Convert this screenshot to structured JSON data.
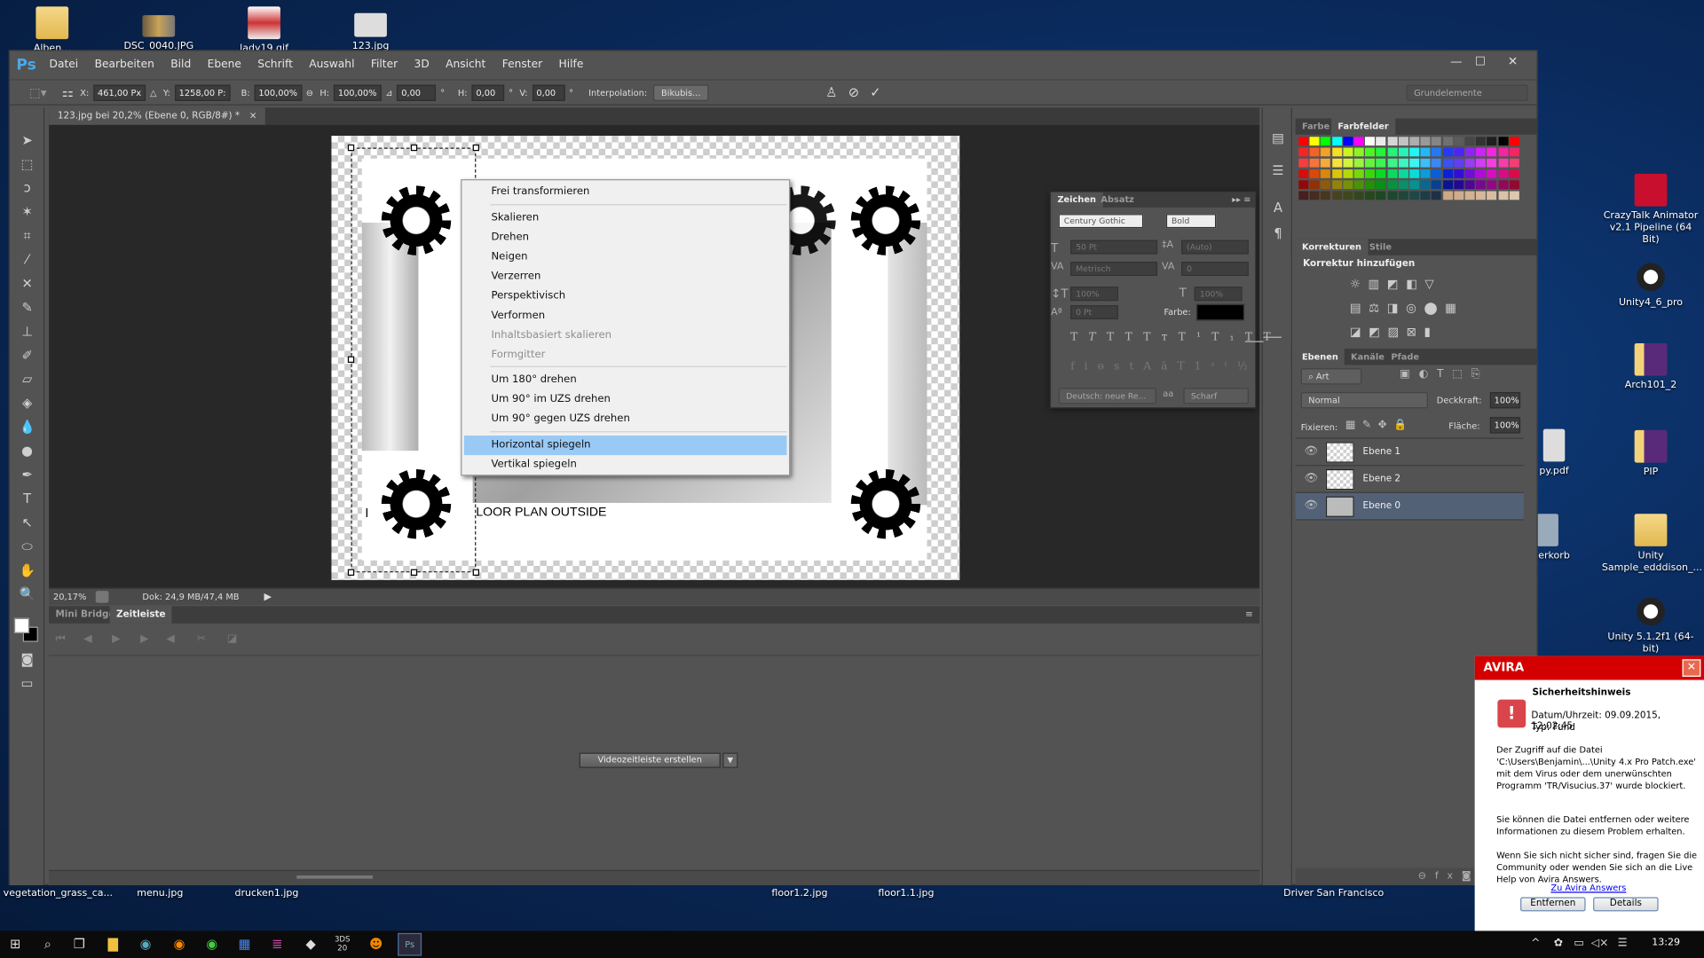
{
  "desktop": {
    "top_icons": [
      {
        "label": "Alben..."
      },
      {
        "label": "DSC_0040.JPG"
      },
      {
        "label": "lady19.gif"
      },
      {
        "label": "123.jpg"
      }
    ],
    "right_icons": [
      {
        "label": "CrazyTalk Animator v2.1 Pipeline (64 Bit)"
      },
      {
        "label": "Unity4_6_pro"
      },
      {
        "label": "Arch101_2"
      },
      {
        "label": "PIP"
      },
      {
        "label": "Unity Sample_edddison_..."
      },
      {
        "label": "Unity 5.1.2f1 (64-bit)"
      }
    ],
    "partial_icons": [
      {
        "label": "py.pdf"
      },
      {
        "label": "erkorb"
      }
    ],
    "bottom_labels": [
      "vegetation_grass_ca...",
      "menu.jpg",
      "drucken1.jpg",
      "floor1.2.jpg",
      "floor1.1.jpg",
      "Driver San Francisco"
    ]
  },
  "photoshop": {
    "logo": "Ps",
    "menu": [
      "Datei",
      "Bearbeiten",
      "Bild",
      "Ebene",
      "Schrift",
      "Auswahl",
      "Filter",
      "3D",
      "Ansicht",
      "Fenster",
      "Hilfe"
    ],
    "window_buttons": {
      "minimize": "—",
      "maximize": "☐",
      "close": "✕"
    },
    "options": {
      "x_label": "X:",
      "x": "461,00 Px",
      "y_label": "Y:",
      "y": "1258,00 P:",
      "b_label": "B:",
      "b": "100,00%",
      "h_label": "H:",
      "h": "100,00%",
      "angle": "0,00",
      "deg": "°",
      "hskew_label": "H:",
      "hskew": "0,00",
      "v_label": "V:",
      "v": "0,00",
      "interp_label": "Interpolation:",
      "interp": "Bikubis...",
      "workspace": "Grundelemente"
    },
    "doc_tab": "123.jpg bei 20,2% (Ebene 0, RGB/8#) *",
    "doc_tab_close": "×",
    "canvas_text": {
      "left": "I",
      "main": "LOOR PLAN OUTSIDE"
    },
    "status": {
      "zoom": "20,17%",
      "doc": "Dok: 24,9 MB/47,4 MB"
    },
    "timeline": {
      "tabs": [
        "Mini Bridge",
        "Zeitleiste"
      ],
      "active_tab": "Zeitleiste",
      "create_button": "Videozeitleiste erstellen"
    },
    "context_menu": {
      "items": [
        {
          "label": "Frei transformieren",
          "enabled": true
        },
        {
          "label": "Skalieren",
          "enabled": true
        },
        {
          "label": "Drehen",
          "enabled": true
        },
        {
          "label": "Neigen",
          "enabled": true
        },
        {
          "label": "Verzerren",
          "enabled": true
        },
        {
          "label": "Perspektivisch",
          "enabled": true
        },
        {
          "label": "Verformen",
          "enabled": true
        },
        {
          "label": "Inhaltsbasiert skalieren",
          "enabled": false
        },
        {
          "label": "Formgitter",
          "enabled": false
        },
        {
          "label": "Um 180° drehen",
          "enabled": true
        },
        {
          "label": "Um 90° im UZS drehen",
          "enabled": true
        },
        {
          "label": "Um 90° gegen UZS drehen",
          "enabled": true
        },
        {
          "label": "Horizontal spiegeln",
          "enabled": true,
          "highlighted": true
        },
        {
          "label": "Vertikal spiegeln",
          "enabled": true
        }
      ]
    },
    "character_panel": {
      "tabs": [
        "Zeichen",
        "Absatz"
      ],
      "font": "Century Gothic",
      "style": "Bold",
      "size": "50 Pt",
      "leading": "(Auto)",
      "kerning": "Metrisch",
      "tracking": "0",
      "vscale": "100%",
      "hscale": "100%",
      "baseline": "0 Pt",
      "color_label": "Farbe:",
      "color": "#000000",
      "language": "Deutsch: neue Re...",
      "aa_label": "aa",
      "antialias": "Scharf"
    },
    "swatches_panel": {
      "tabs": [
        "Farbe",
        "Farbfelder"
      ],
      "active": "Farbfelder"
    },
    "adjustments_panel": {
      "tabs": [
        "Korrekturen",
        "Stile"
      ],
      "heading": "Korrektur hinzufügen"
    },
    "layers_panel": {
      "tabs": [
        "Ebenen",
        "Kanäle",
        "Pfade"
      ],
      "filter": "Art",
      "blend_mode": "Normal",
      "opacity_label": "Deckkraft:",
      "opacity": "100%",
      "lock_label": "Fixieren:",
      "fill_label": "Fläche:",
      "fill": "100%",
      "layers": [
        {
          "name": "Ebene 1",
          "visible": true,
          "selected": false
        },
        {
          "name": "Ebene 2",
          "visible": true,
          "selected": false
        },
        {
          "name": "Ebene 0",
          "visible": true,
          "selected": true
        }
      ]
    },
    "accent": "#4aa8e8"
  },
  "avira": {
    "brand": "AVIRA",
    "close": "✕",
    "title": "Sicherheitshinweis",
    "date_line": "Datum/Uhrzeit: 09.09.2015, 12:02:45",
    "type_line": "Typ: Fund",
    "para1": "Der Zugriff auf die Datei 'C:\\Users\\Benjamin\\...\\Unity 4.x Pro Patch.exe' mit dem Virus oder dem unerwünschten Programm 'TR/Visucius.37' wurde blockiert.",
    "para2": "Sie können die Datei entfernen oder weitere Informationen zu diesem Problem erhalten.",
    "para3": "Wenn Sie sich nicht sicher sind, fragen Sie die Community oder wenden Sie sich an die Live Help von Avira Answers.",
    "link": "Zu Avira Answers",
    "btn_remove": "Entfernen",
    "btn_details": "Details",
    "brand_color": "#d40000"
  },
  "taskbar": {
    "clock": "13:29"
  }
}
